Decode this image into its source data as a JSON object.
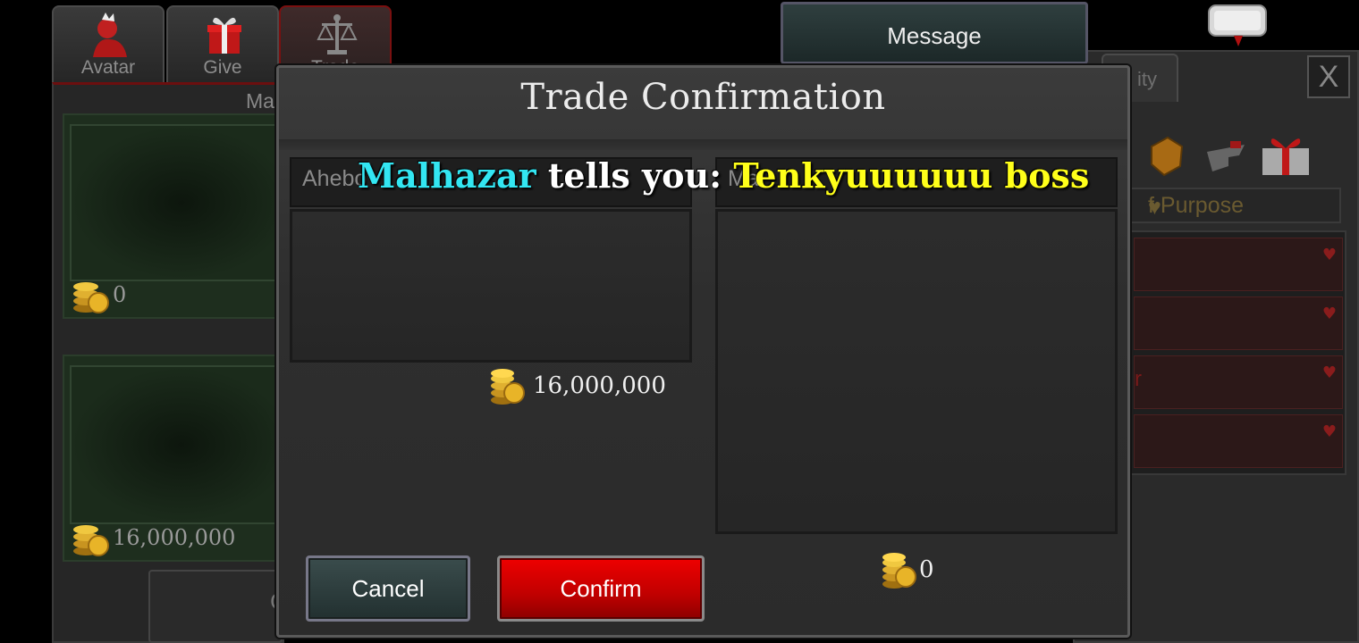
{
  "background": {
    "tabs": [
      {
        "label": "Avatar"
      },
      {
        "label": "Give"
      },
      {
        "label": "Trade"
      }
    ],
    "left_panel": {
      "title": "Ma",
      "my_gold": "0",
      "their_gold": "16,000,000",
      "button_label": "C"
    },
    "message_button": "Message",
    "right_panel": {
      "tab_label": "ity",
      "close_label": "X",
      "header": "f Purpose",
      "row_partial_text": "r"
    }
  },
  "modal": {
    "title": "Trade Confirmation",
    "left_offer": {
      "player": "Ahebo",
      "gold": "16,000,000"
    },
    "right_offer": {
      "player": "Mal",
      "gold": "0"
    },
    "cancel_label": "Cancel",
    "confirm_label": "Confirm"
  },
  "chat": {
    "sender": "Malhazar",
    "connector": "tells you:",
    "message": "Tenkyuuuuuu boss"
  },
  "colors": {
    "sender": "#33e6f2",
    "message": "#ffff1a",
    "confirm": "#d80000",
    "cancel": "#2f4040"
  }
}
